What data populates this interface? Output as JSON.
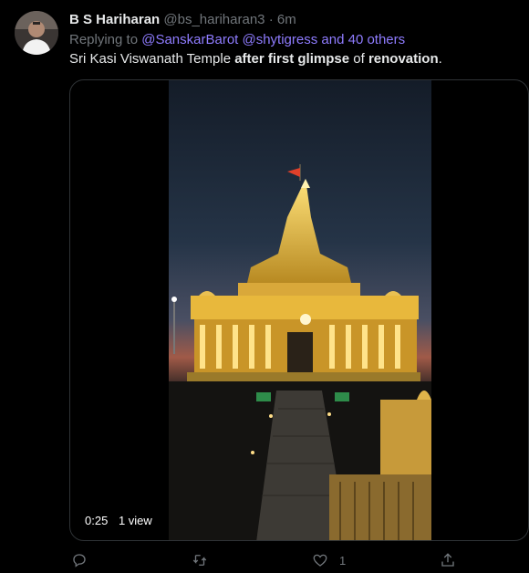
{
  "tweet": {
    "author_name": "B S Hariharan",
    "handle": "@bs_hariharan3",
    "separator": "·",
    "time": "6m",
    "replying_to_prefix": "Replying to",
    "replying_to_users": "@SanskarBarot @shytigress and 40 others",
    "text": {
      "part1": "Sri Kasi Viswanath Temple ",
      "part2": "after first glimpse",
      "part3": " of ",
      "part4": "renovation",
      "part5": "."
    },
    "media": {
      "duration": "0:25",
      "views": "1 view"
    },
    "actions": {
      "reply_icon": "reply-icon",
      "retweet_icon": "retweet-icon",
      "like_icon": "heart-icon",
      "like_count": "1",
      "share_icon": "share-icon"
    }
  },
  "colors": {
    "background": "#000000",
    "text": "#e7e9ea",
    "muted": "#71767b",
    "link": "#8f7cff",
    "border": "#2f3336"
  }
}
